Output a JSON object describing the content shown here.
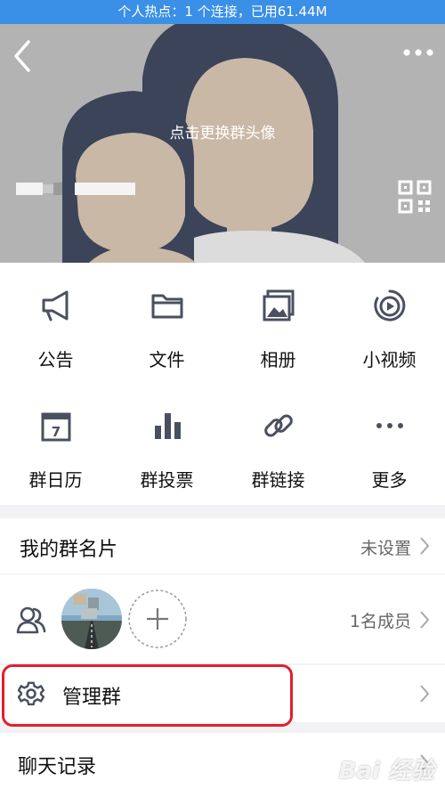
{
  "status_bar": {
    "text": "个人热点：1 个连接，已用61.44M"
  },
  "header": {
    "avatar_hint": "点击更换群头像"
  },
  "features": [
    {
      "label": "公告",
      "icon": "megaphone-icon"
    },
    {
      "label": "文件",
      "icon": "folder-icon"
    },
    {
      "label": "相册",
      "icon": "photo-album-icon"
    },
    {
      "label": "小视频",
      "icon": "video-play-icon"
    },
    {
      "label": "群日历",
      "icon": "calendar-icon"
    },
    {
      "label": "群投票",
      "icon": "bar-chart-icon"
    },
    {
      "label": "群链接",
      "icon": "link-icon"
    },
    {
      "label": "更多",
      "icon": "more-dots-icon"
    }
  ],
  "group_card": {
    "title": "我的群名片",
    "value": "未设置"
  },
  "members": {
    "count_label": "1名成员"
  },
  "manage": {
    "title": "管理群"
  },
  "chat_history": {
    "title": "聊天记录"
  },
  "watermark": {
    "text": "Bai 经验"
  },
  "colors": {
    "status_bar": "#3a8fe6",
    "icon": "#4a5060",
    "highlight": "#e0202a"
  }
}
